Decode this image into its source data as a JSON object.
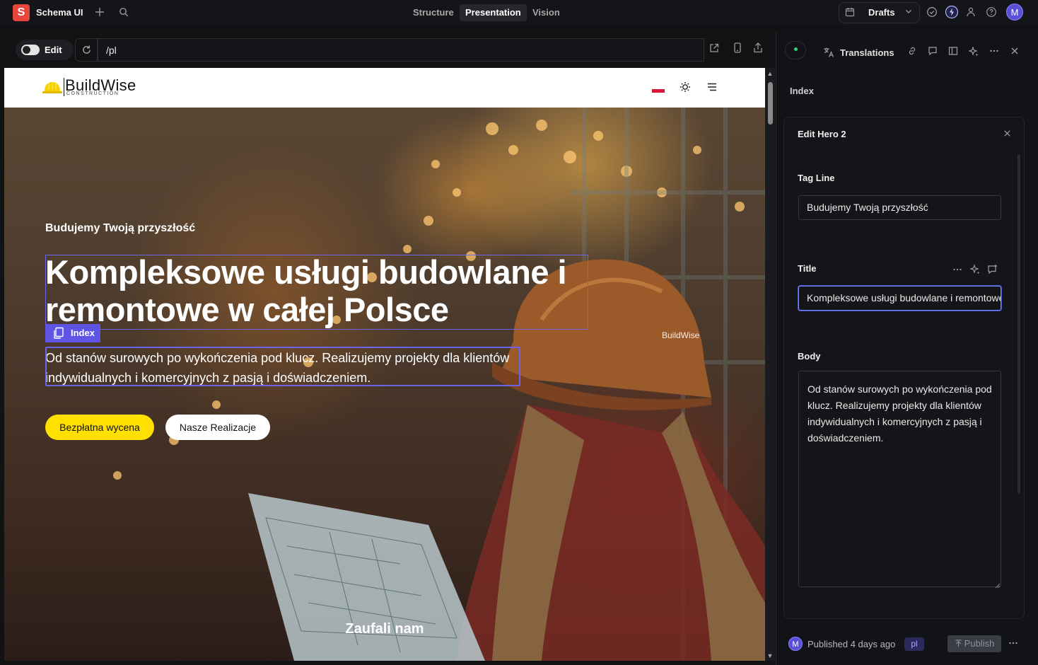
{
  "app": {
    "logo_letter": "S",
    "title": "Schema UI",
    "add_icon": "plus-icon",
    "search_icon": "search-icon"
  },
  "top_tabs": [
    {
      "label": "Structure",
      "active": false
    },
    {
      "label": "Presentation",
      "active": true
    },
    {
      "label": "Vision",
      "active": false
    }
  ],
  "top_right": {
    "drafts_label": "Drafts",
    "avatar_letter": "M"
  },
  "editor_toolbar": {
    "edit_label": "Edit",
    "url": "/pl"
  },
  "site": {
    "brand": "BuildWise",
    "brand_sub": "CONSTRUCTION",
    "hero": {
      "tagline": "Budujemy Twoją przyszłość",
      "title": "Kompleksowe usługi budowlane i remontowe w całej Polsce",
      "body": "Od stanów surowych po wykończenia pod klucz. Realizujemy projekty dla klientów indywidualnych i komercyjnych z pasją i doświadczeniem.",
      "primary_button": "Bezpłatna wycena",
      "secondary_button": "Nasze Realizacje",
      "trusted_heading": "Zaufali nam"
    },
    "selection_tag": "Index"
  },
  "right_panel": {
    "translations_label": "Translations",
    "breadcrumb": "Index",
    "form_title": "Edit Hero 2",
    "fields": {
      "tag_line_label": "Tag Line",
      "tag_line_value": "Budujemy Twoją przyszłość",
      "title_label": "Title",
      "title_value": "Kompleksowe usługi budowlane i remontowe w całej Polsce",
      "body_label": "Body",
      "body_value": "Od stanów surowych po wykończenia pod klucz. Realizujemy projekty dla klientów indywidualnych i komercyjnych z pasją i doświadczeniem."
    },
    "footer": {
      "avatar_letter": "M",
      "published": "Published 4 days ago",
      "lang": "pl",
      "publish_label": "Publish"
    }
  },
  "colors": {
    "accent": "#5e55e6",
    "brand_red": "#e8453c",
    "cta_yellow": "#ffe000"
  }
}
